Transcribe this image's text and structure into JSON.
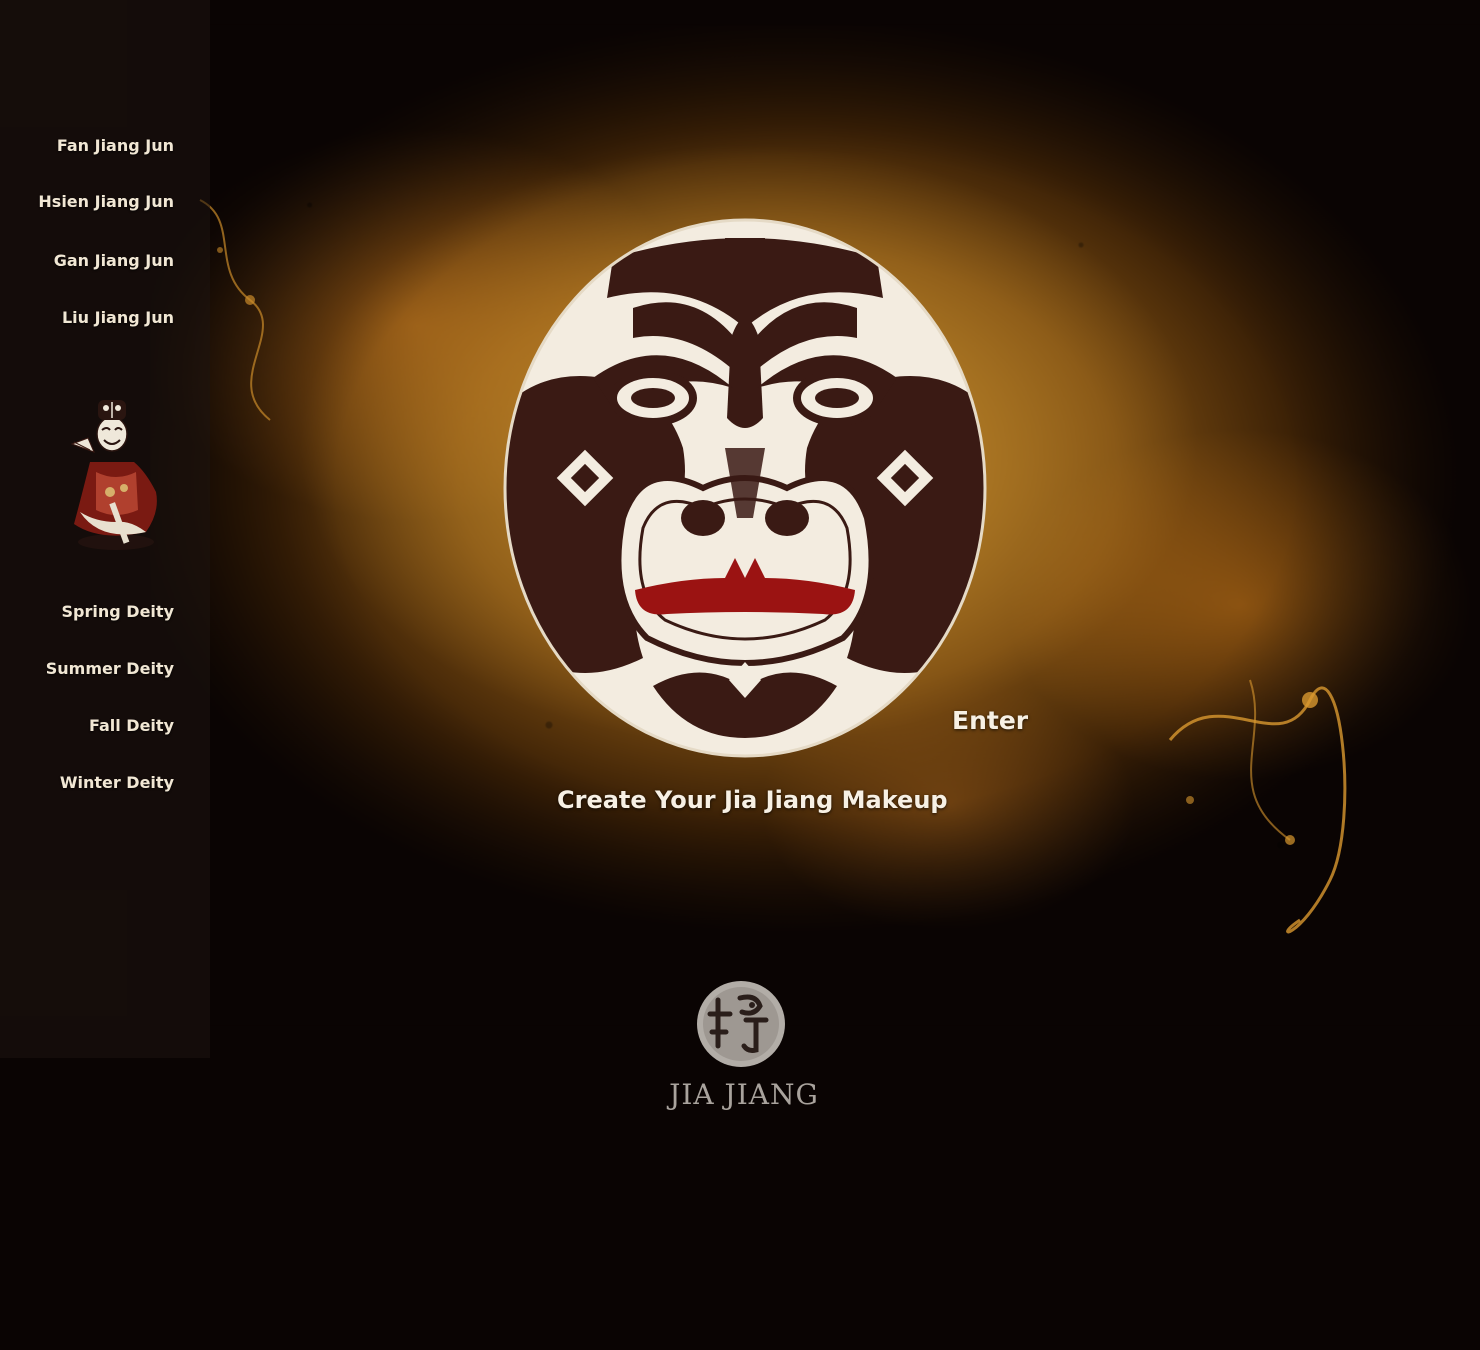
{
  "sidebar": {
    "nav_top": [
      {
        "label": "Fan Jiang Jun"
      },
      {
        "label": "Hsien Jiang Jun"
      },
      {
        "label": "Gan Jiang Jun"
      },
      {
        "label": "Liu Jiang Jun"
      }
    ],
    "nav_bottom": [
      {
        "label": "Spring Deity"
      },
      {
        "label": "Summer Deity"
      },
      {
        "label": "Fall Deity"
      },
      {
        "label": "Winter Deity"
      }
    ]
  },
  "main": {
    "enter_label": "Enter",
    "create_label": "Create Your Jia Jiang Makeup"
  },
  "logo": {
    "wordmark": "JIA JIANG"
  },
  "colors": {
    "background": "#0a0403",
    "parchment": "#a87422",
    "text": "#f1e7d4",
    "mask_red": "#9b1312",
    "mask_dark": "#3a1a14",
    "mask_white": "#f3ece0"
  }
}
